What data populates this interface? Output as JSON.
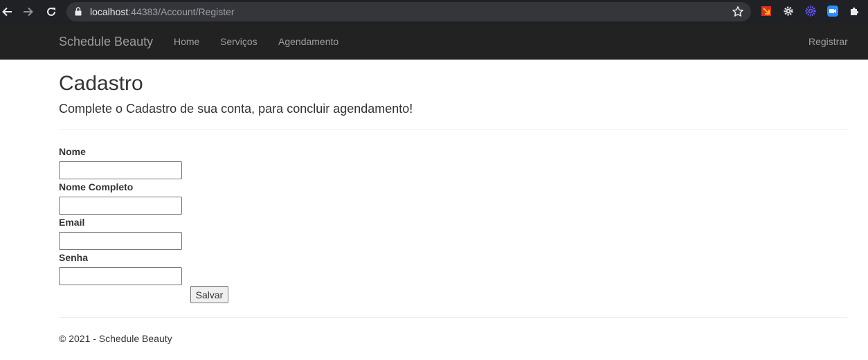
{
  "browser": {
    "url_host": "localhost",
    "url_rest": ":44383/Account/Register",
    "icons": [
      "back-arrow-icon",
      "forward-arrow-icon",
      "reload-icon",
      "lock-icon",
      "bookmark-star-icon",
      "extension-icons",
      "puzzle-icon"
    ]
  },
  "navbar": {
    "brand": "Schedule Beauty",
    "links": [
      "Home",
      "Serviços",
      "Agendamento"
    ],
    "register": "Registrar",
    "background": "#222222",
    "link_color": "#9d9d9d"
  },
  "page": {
    "title": "Cadastro",
    "subtitle": "Complete o Cadastro de sua conta, para concluir agendamento!"
  },
  "form": {
    "fields": [
      {
        "label": "Nome",
        "value": ""
      },
      {
        "label": "Nome Completo",
        "value": ""
      },
      {
        "label": "Email",
        "value": ""
      },
      {
        "label": "Senha",
        "value": ""
      }
    ],
    "submit_label": "Salvar"
  },
  "footer": {
    "text": "© 2021 - Schedule Beauty"
  }
}
